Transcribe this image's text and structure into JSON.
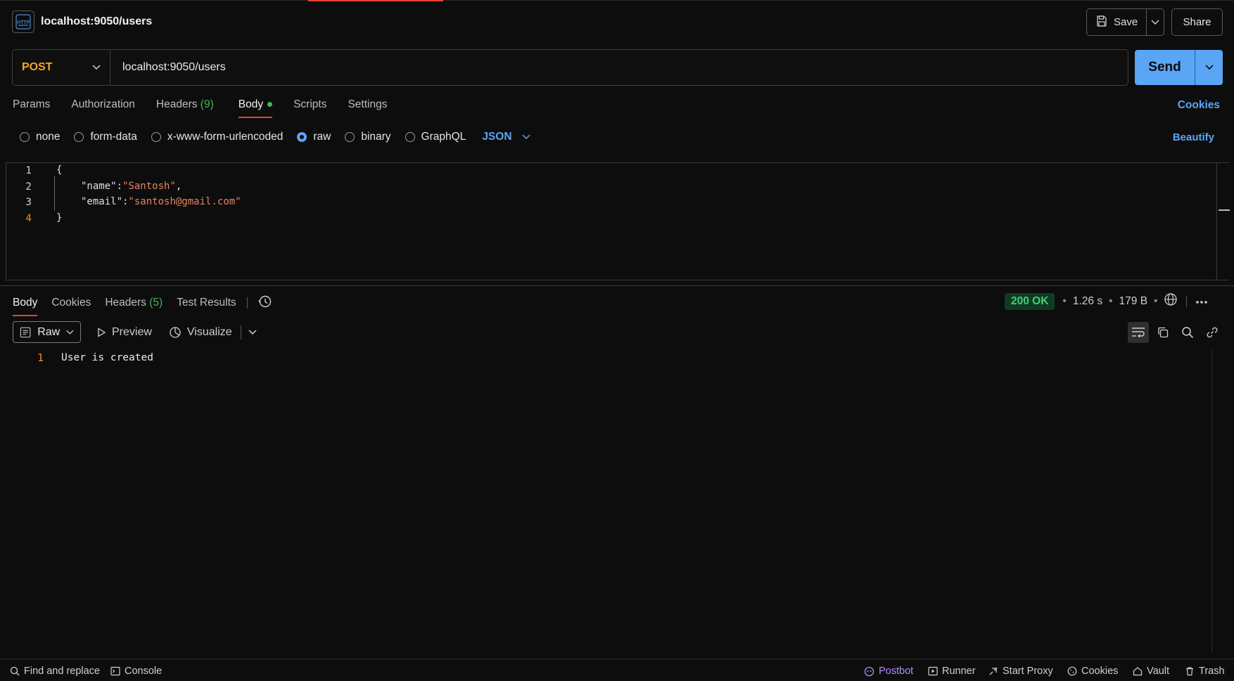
{
  "header": {
    "title": "localhost:9050/users",
    "save_label": "Save",
    "share_label": "Share"
  },
  "request": {
    "method": "POST",
    "url": "localhost:9050/users",
    "send_label": "Send"
  },
  "request_tabs": [
    {
      "label": "Params"
    },
    {
      "label": "Authorization"
    },
    {
      "label": "Headers",
      "count": "(9)"
    },
    {
      "label": "Body",
      "active": true
    },
    {
      "label": "Scripts"
    },
    {
      "label": "Settings"
    }
  ],
  "cookies_link": "Cookies",
  "body_types": {
    "options": [
      "none",
      "form-data",
      "x-www-form-urlencoded",
      "raw",
      "binary",
      "GraphQL"
    ],
    "selected": "raw",
    "format": "JSON",
    "beautify_label": "Beautify"
  },
  "editor": {
    "line_numbers": [
      "1",
      "2",
      "3",
      "4"
    ],
    "lines": {
      "l1": "{",
      "l2_key": "\"name\"",
      "l2_val": "\"Santosh\"",
      "l3_key": "\"email\"",
      "l3_val": "\"santosh@gmail.com\"",
      "l4": "}"
    }
  },
  "response": {
    "tabs": [
      {
        "label": "Body",
        "active": true
      },
      {
        "label": "Cookies"
      },
      {
        "label": "Headers",
        "count": "(5)"
      },
      {
        "label": "Test Results"
      }
    ],
    "status": "200 OK",
    "time": "1.26 s",
    "size": "179 B",
    "view_mode": "Raw",
    "preview_label": "Preview",
    "visualize_label": "Visualize",
    "line_number": "1",
    "body_text": "User is created"
  },
  "footer": {
    "left": [
      "Find and replace",
      "Console"
    ],
    "right": [
      "Postbot",
      "Runner",
      "Start Proxy",
      "Cookies",
      "Vault",
      "Trash"
    ]
  },
  "colors": {
    "accent_blue": "#5aa5f5",
    "method_post": "#f5a623",
    "status_ok": "#3fd07a",
    "tab_underline": "#e2452f",
    "json_string": "#e8845f"
  }
}
